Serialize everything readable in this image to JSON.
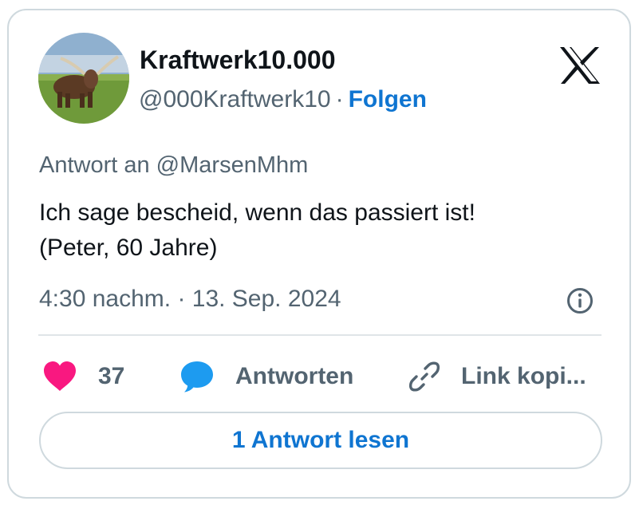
{
  "author": {
    "display_name": "Kraftwerk10.000",
    "handle": "@000Kraftwerk10",
    "separator": "·",
    "follow_label": "Folgen"
  },
  "platform_icon": "x-logo-icon",
  "reply_to": "Antwort an @MarsenMhm",
  "tweet": {
    "text_line_1": "Ich sage bescheid, wenn das passiert ist!",
    "text_line_2": "(Peter, 60 Jahre)"
  },
  "timestamp": "4:30 nachm. · 13. Sep. 2024",
  "actions": {
    "like_count": "37",
    "reply_label": "Antworten",
    "copy_link_label": "Link kopi..."
  },
  "read_replies_label": "1 Antwort lesen",
  "colors": {
    "accent": "#0f75d1",
    "like": "#f91880",
    "reply_bubble": "#1d9bf0",
    "secondary_text": "#536471",
    "border": "#cfd9de"
  }
}
